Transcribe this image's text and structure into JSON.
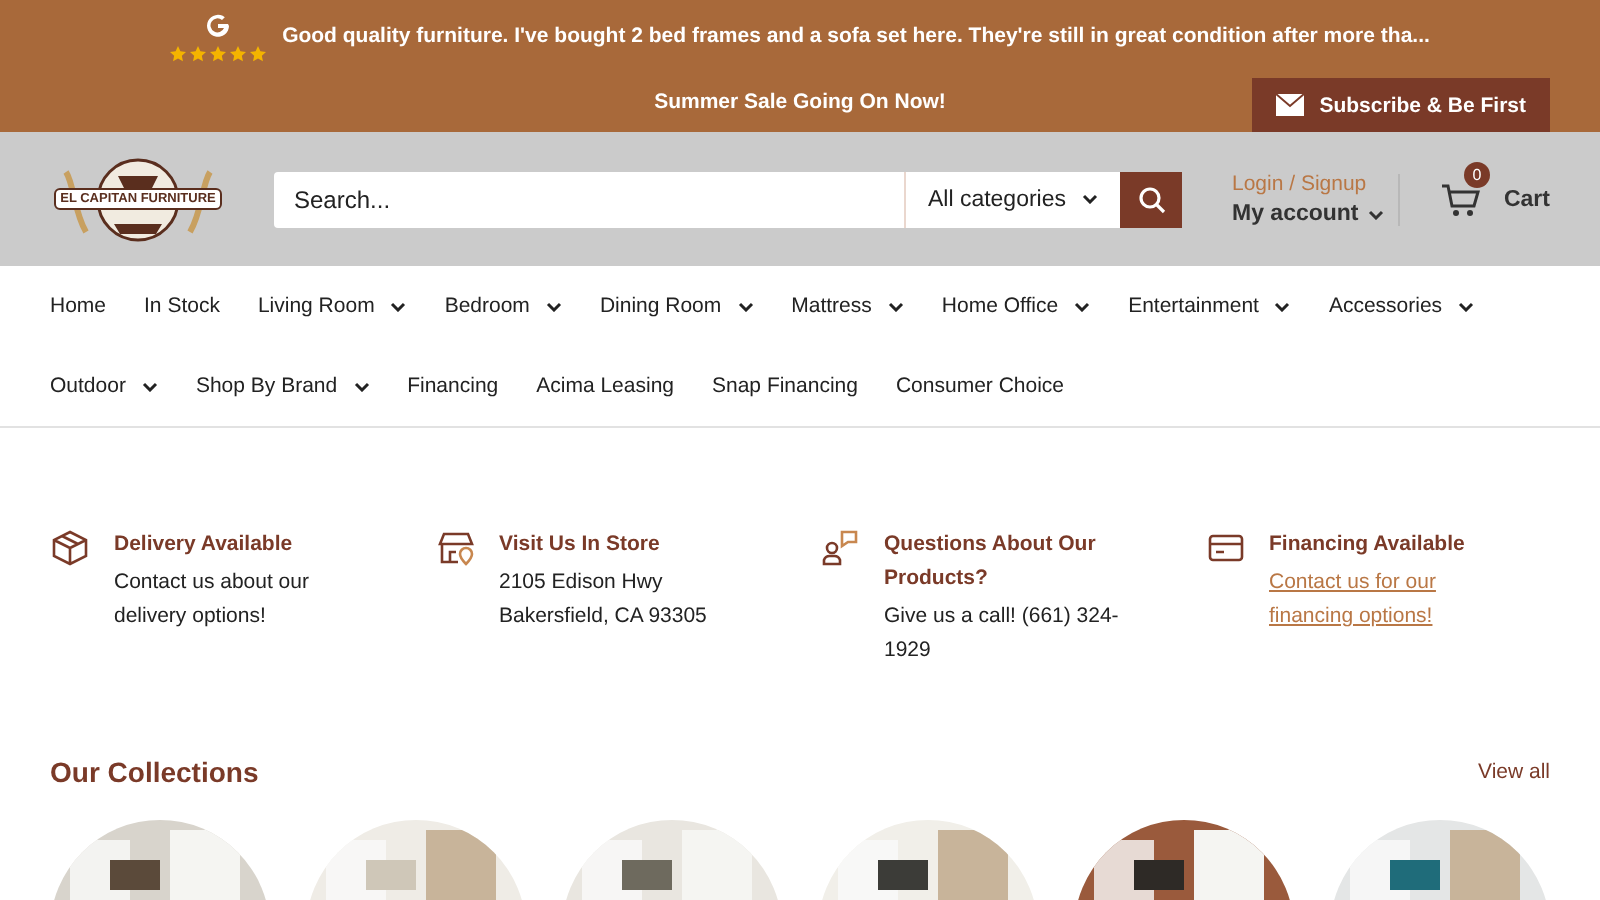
{
  "review": {
    "stars": 5,
    "text": "Good quality furniture. I've bought 2 bed frames and a sofa set here. They're still in great condition after more tha..."
  },
  "announcement": "Summer Sale Going On Now!",
  "subscribe_button": "Subscribe & Be First",
  "header": {
    "logo": "EL CAPITAN FURNITURE",
    "search": {
      "placeholder": "Search..."
    },
    "category": "All categories",
    "account": {
      "login": "Login / Signup",
      "label": "My account"
    },
    "cart": {
      "count": "0",
      "label": "Cart"
    }
  },
  "nav": [
    [
      {
        "label": "Home",
        "dropdown": false
      },
      {
        "label": "In Stock",
        "dropdown": false
      },
      {
        "label": "Living Room",
        "dropdown": true
      },
      {
        "label": "Bedroom",
        "dropdown": true
      },
      {
        "label": "Dining Room",
        "dropdown": true
      },
      {
        "label": "Mattress",
        "dropdown": true
      },
      {
        "label": "Home Office",
        "dropdown": true
      },
      {
        "label": "Entertainment",
        "dropdown": true
      },
      {
        "label": "Accessories",
        "dropdown": true
      }
    ],
    [
      {
        "label": "Outdoor",
        "dropdown": true
      },
      {
        "label": "Shop By Brand",
        "dropdown": true
      },
      {
        "label": "Financing",
        "dropdown": false
      },
      {
        "label": "Acima Leasing",
        "dropdown": false
      },
      {
        "label": "Snap Financing",
        "dropdown": false
      },
      {
        "label": "Consumer Choice",
        "dropdown": false
      }
    ]
  ],
  "features": [
    {
      "kind": "box",
      "title": "Delivery Available",
      "lines": [
        "Contact us about our delivery options!"
      ],
      "link": false
    },
    {
      "kind": "store",
      "title": "Visit Us In Store",
      "lines": [
        "2105 Edison Hwy",
        "Bakersfield, CA 93305"
      ],
      "link": false
    },
    {
      "kind": "chat",
      "title": "Questions About Our Products?",
      "lines": [
        "Give us a call! (661) 324-1929"
      ],
      "link": false
    },
    {
      "kind": "card",
      "title": "Financing Available",
      "lines": [
        "Contact us for our financing options!"
      ],
      "link": true
    }
  ],
  "collections": {
    "title": "Our Collections",
    "view_all": "View all"
  }
}
